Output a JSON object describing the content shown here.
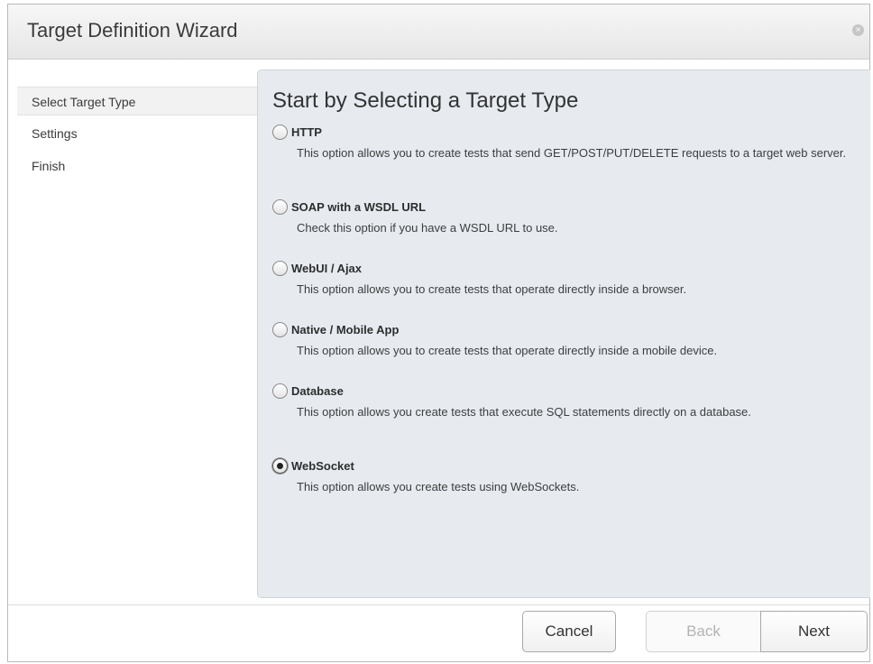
{
  "dialog": {
    "title": "Target Definition Wizard",
    "close_icon": "×"
  },
  "sidebar": {
    "items": [
      {
        "label": "Select Target Type",
        "active": true
      },
      {
        "label": "Settings",
        "active": false
      },
      {
        "label": "Finish",
        "active": false
      }
    ]
  },
  "main": {
    "heading": "Start by Selecting a Target Type",
    "selected": "WebSocket",
    "options": [
      {
        "label": "HTTP",
        "description": "This option allows you to create tests that send GET/POST/PUT/DELETE requests to a target web server."
      },
      {
        "label": "SOAP with a WSDL URL",
        "description": "Check this option if you have a WSDL URL to use."
      },
      {
        "label": "WebUI / Ajax",
        "description": "This option allows you to create tests that operate directly inside a browser."
      },
      {
        "label": "Native / Mobile App",
        "description": "This option allows you to create tests that operate directly inside a mobile device."
      },
      {
        "label": "Database",
        "description": "This option allows you create tests that execute SQL statements directly on a database."
      },
      {
        "label": "WebSocket",
        "description": "This option allows you create tests using WebSockets."
      }
    ]
  },
  "footer": {
    "cancel_label": "Cancel",
    "back_label": "Back",
    "next_label": "Next",
    "back_disabled": true
  }
}
